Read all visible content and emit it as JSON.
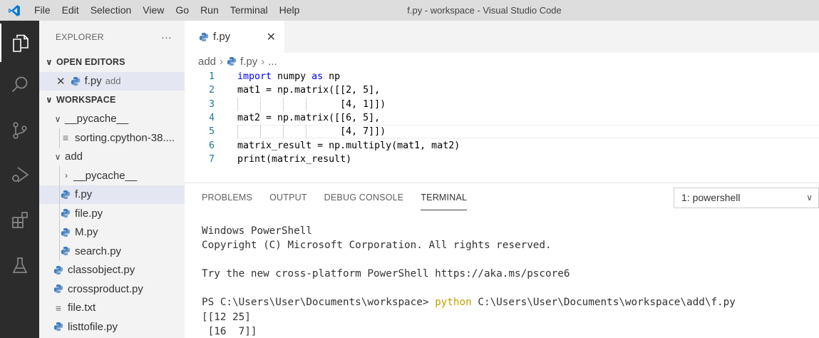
{
  "window": {
    "title": "f.py - workspace - Visual Studio Code",
    "menu": [
      "File",
      "Edit",
      "Selection",
      "View",
      "Go",
      "Run",
      "Terminal",
      "Help"
    ]
  },
  "activity_bar": {
    "items": [
      "explorer-icon",
      "search-icon",
      "source-control-icon",
      "run-debug-icon",
      "extensions-icon",
      "testing-icon"
    ]
  },
  "sidebar": {
    "header": "EXPLORER",
    "more": "···",
    "open_editors": {
      "label": "OPEN EDITORS",
      "items": [
        {
          "name": "f.py",
          "folder": "add"
        }
      ]
    },
    "workspace": {
      "label": "WORKSPACE",
      "items": [
        {
          "label": "__pycache__",
          "expanded": true
        },
        {
          "label": "sorting.cpython-38...."
        },
        {
          "label": "add",
          "expanded": true
        },
        {
          "label": "__pycache__",
          "expanded": false
        },
        {
          "label": "f.py"
        },
        {
          "label": "file.py"
        },
        {
          "label": "M.py"
        },
        {
          "label": "search.py"
        },
        {
          "label": "classobject.py"
        },
        {
          "label": "crossproduct.py"
        },
        {
          "label": "file.txt"
        },
        {
          "label": "listtofile.py"
        }
      ]
    }
  },
  "editor": {
    "tab_label": "f.py",
    "breadcrumb": [
      "add",
      "f.py",
      "..."
    ],
    "lines": [
      {
        "num": "1",
        "kw": "import",
        "mid": " numpy ",
        "kw2": "as",
        "rest": " np"
      },
      {
        "num": "2",
        "text": "mat1 = np.matrix([[2, 5],"
      },
      {
        "num": "3",
        "text": "                  [4, 1]])"
      },
      {
        "num": "4",
        "text": "mat2 = np.matrix([[6, 5],"
      },
      {
        "num": "5",
        "text": "                  [4, 7]])"
      },
      {
        "num": "6",
        "text": "matrix_result = np.multiply(mat1, mat2)"
      },
      {
        "num": "7",
        "text": "print(matrix_result)"
      }
    ]
  },
  "panel": {
    "tabs": [
      "PROBLEMS",
      "OUTPUT",
      "DEBUG CONSOLE",
      "TERMINAL"
    ],
    "active_tab": "TERMINAL",
    "terminal_select": "1: powershell",
    "terminal": {
      "l1": "Windows PowerShell",
      "l2": "Copyright (C) Microsoft Corporation. All rights reserved.",
      "l3": "Try the new cross-platform PowerShell https://aka.ms/pscore6",
      "prompt": "PS C:\\Users\\User\\Documents\\workspace> ",
      "cmd": "python",
      "arg": " C:\\Users\\User\\Documents\\workspace\\add\\f.py",
      "out1": "[[12 25]",
      "out2": " [16  7]]"
    }
  },
  "colors": {
    "python_icon": "#3f7cbf",
    "keyword": "#0000ff",
    "line_number": "#237893",
    "activity_bar": "#2c2c2c",
    "command": "#c4a000"
  }
}
